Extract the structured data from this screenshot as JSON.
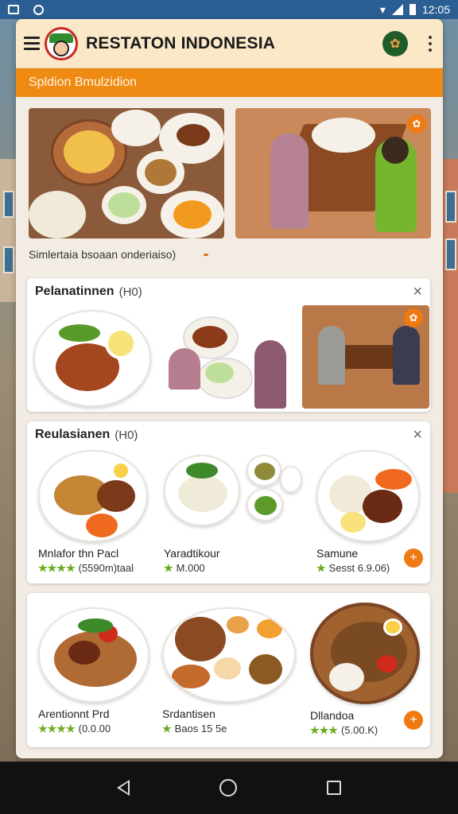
{
  "status_bar": {
    "time": "12:05"
  },
  "app": {
    "title": "RESTATON INDONESIA",
    "banner": "Spldion Bmulzidion",
    "hero_caption": "Simlertaia bsoaan onderiaiso)"
  },
  "sections": [
    {
      "title": "Pelanatinnen",
      "count": "(H0)",
      "close_icon": "×",
      "images": [
        "bento-plate",
        "dining-scene",
        "couple-at-table"
      ]
    },
    {
      "title": "Reulasianen",
      "count": "(H0)",
      "close_icon": "×",
      "dishes": [
        {
          "name": "Mnlafor thn Pacl",
          "rating": "(5590m)taal"
        },
        {
          "name": "Yaradtikour",
          "rating": "M.000"
        },
        {
          "name": "Samune",
          "rating": "Sesst 6.9.06)"
        }
      ]
    },
    {
      "title": "",
      "dishes": [
        {
          "name": "Arentionnt Prd",
          "rating": "(0.0.00"
        },
        {
          "name": "Srdantisen",
          "rating": "Baos 15 5e"
        },
        {
          "name": "Dllandoa",
          "rating": "(5.00.K)"
        }
      ]
    }
  ],
  "icons": {
    "menu": "hamburger-icon",
    "more": "kebab-icon",
    "add": "+",
    "badge": "✿"
  },
  "colors": {
    "accent": "#ef8a12",
    "appbar": "#fbe8c8",
    "statusbar": "#2b5f93",
    "stars": "#6cab1e"
  }
}
